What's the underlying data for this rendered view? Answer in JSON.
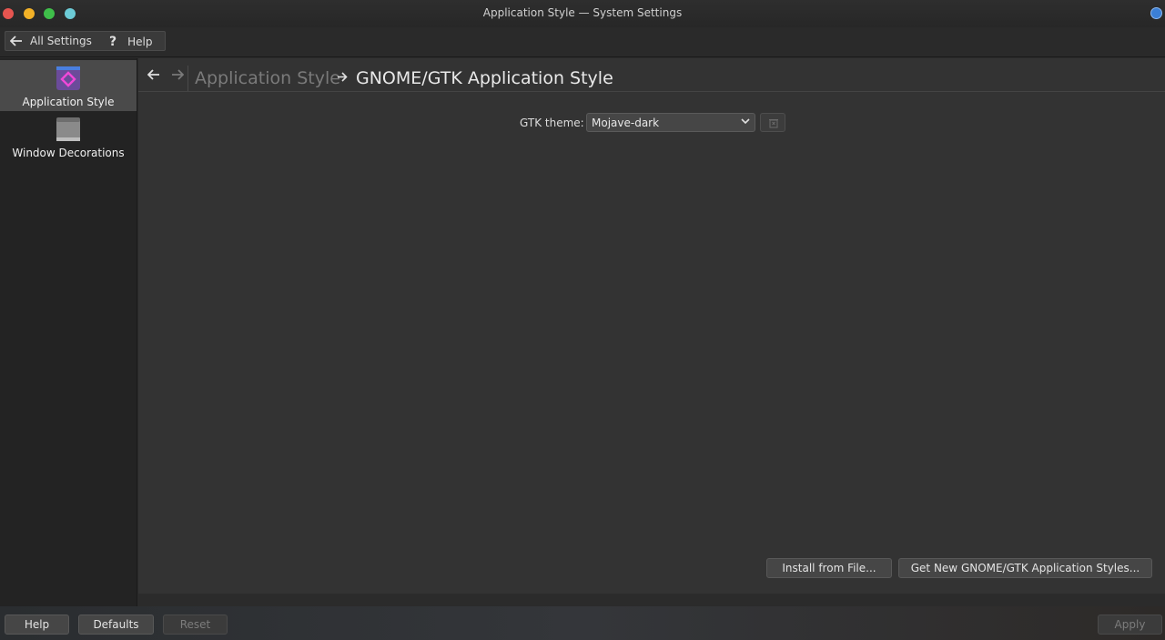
{
  "window": {
    "title": "Application Style — System Settings",
    "traffic_colors": [
      "#e65550",
      "#f2b127",
      "#3fbf4a",
      "#6ccbd6"
    ]
  },
  "toolbar": {
    "all_settings_label": "All Settings",
    "help_label": "Help"
  },
  "sidebar": {
    "items": [
      {
        "label": "Application Style",
        "icon": "application-style-icon",
        "selected": true
      },
      {
        "label": "Window Decorations",
        "icon": "window-decorations-icon",
        "selected": false
      }
    ]
  },
  "breadcrumb": {
    "parent": "Application Style",
    "current": "GNOME/GTK Application Style"
  },
  "gtk": {
    "label": "GTK theme:",
    "selected_theme": "Mojave-dark"
  },
  "actions": {
    "install_from_file": "Install from File...",
    "get_new_styles": "Get New GNOME/GTK Application Styles..."
  },
  "footer": {
    "help": "Help",
    "defaults": "Defaults",
    "reset": "Reset",
    "apply": "Apply"
  },
  "colors": {
    "accent_pink": "#e040c8",
    "accent_blue": "#3b7fd6"
  }
}
